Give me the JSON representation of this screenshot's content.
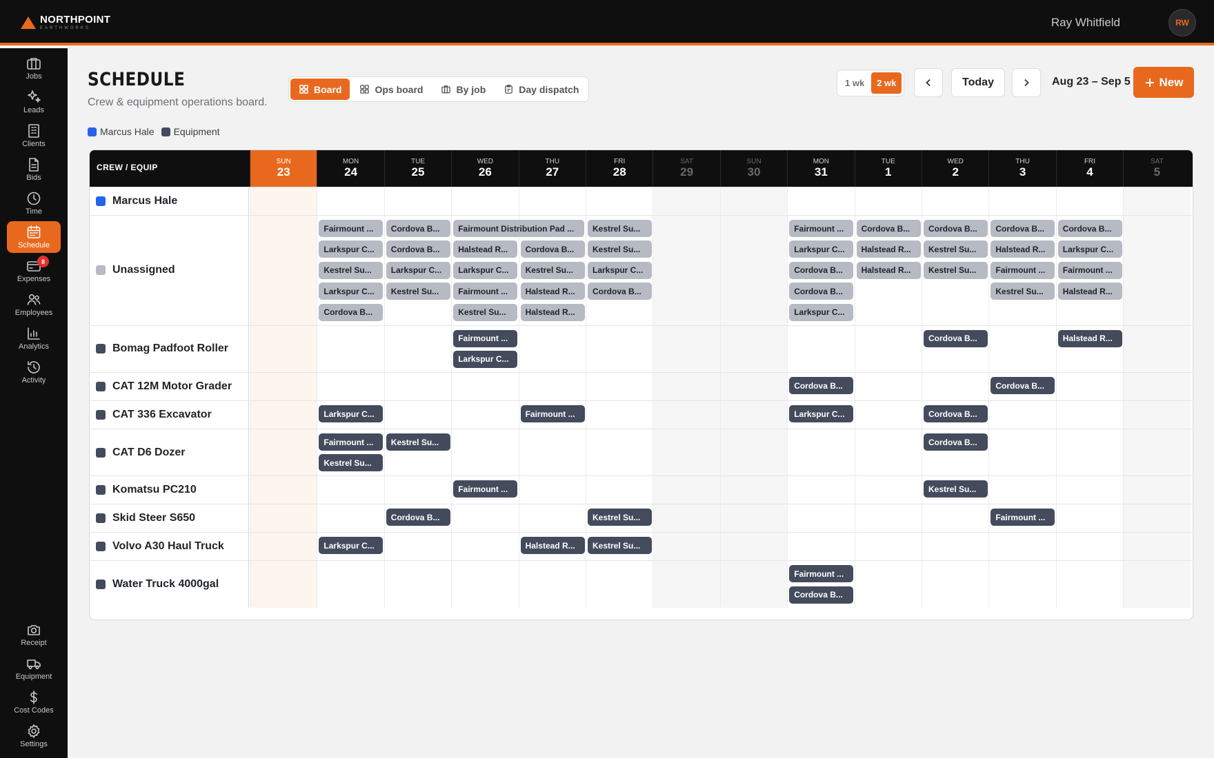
{
  "brand": {
    "name": "NORTHPOINT",
    "sub": "EARTHWORKS",
    "accent": "#e8691e"
  },
  "user": {
    "name": "Ray Whitfield",
    "initials": "RW"
  },
  "sidebar": {
    "items": [
      {
        "label": "Jobs",
        "icon": "briefcase-icon"
      },
      {
        "label": "Leads",
        "icon": "sparkles-icon"
      },
      {
        "label": "Clients",
        "icon": "building-icon"
      },
      {
        "label": "Bids",
        "icon": "document-icon"
      },
      {
        "label": "Time",
        "icon": "clock-icon"
      },
      {
        "label": "Schedule",
        "icon": "calendar-icon",
        "active": true
      },
      {
        "label": "Expenses",
        "icon": "credit-card-icon",
        "badge": "8"
      },
      {
        "label": "Employees",
        "icon": "users-icon"
      },
      {
        "label": "Analytics",
        "icon": "bar-chart-icon"
      },
      {
        "label": "Activity",
        "icon": "history-icon"
      }
    ],
    "bottom": [
      {
        "label": "Receipt",
        "icon": "camera-icon"
      },
      {
        "label": "Equipment",
        "icon": "truck-icon"
      },
      {
        "label": "Cost Codes",
        "icon": "dollar-icon"
      },
      {
        "label": "Settings",
        "icon": "gear-icon"
      }
    ]
  },
  "header": {
    "title": "SCHEDULE",
    "subtitle": "Crew & equipment operations board.",
    "views": [
      "Board",
      "Ops board",
      "By job",
      "Day dispatch"
    ],
    "active_view": "Board",
    "weeks": [
      "1 wk",
      "2 wk"
    ],
    "active_week": "2 wk",
    "today_label": "Today",
    "date_range": "Aug 23 – Sep 5",
    "new_label": "New"
  },
  "legend": [
    {
      "label": "Marcus Hale",
      "color": "#2563eb"
    },
    {
      "label": "Equipment",
      "color": "#434b5c"
    }
  ],
  "board": {
    "crew_header": "CREW / EQUIP",
    "days": [
      {
        "dow": "SUN",
        "num": "23",
        "today": true,
        "weekend": true
      },
      {
        "dow": "MON",
        "num": "24"
      },
      {
        "dow": "TUE",
        "num": "25"
      },
      {
        "dow": "WED",
        "num": "26"
      },
      {
        "dow": "THU",
        "num": "27"
      },
      {
        "dow": "FRI",
        "num": "28"
      },
      {
        "dow": "SAT",
        "num": "29",
        "weekend": true
      },
      {
        "dow": "SUN",
        "num": "30",
        "weekend": true
      },
      {
        "dow": "MON",
        "num": "31"
      },
      {
        "dow": "TUE",
        "num": "1"
      },
      {
        "dow": "WED",
        "num": "2"
      },
      {
        "dow": "THU",
        "num": "3"
      },
      {
        "dow": "FRI",
        "num": "4"
      },
      {
        "dow": "SAT",
        "num": "5",
        "weekend": true
      }
    ],
    "rows": [
      {
        "label": "Marcus Hale",
        "color": "#2563eb",
        "kind": "crew",
        "cells": [
          [],
          [],
          [],
          [],
          [],
          [],
          [],
          [],
          [],
          [],
          [],
          [],
          [],
          []
        ]
      },
      {
        "label": "Unassigned",
        "color": "#b6bac2",
        "kind": "unassigned",
        "cells": [
          [],
          [
            "Fairmount ...",
            "Larkspur C...",
            "Kestrel Su...",
            "Larkspur C...",
            "Cordova B..."
          ],
          [
            "Cordova B...",
            "Cordova B...",
            "Larkspur C...",
            "Kestrel Su..."
          ],
          [
            "Fairmount Distribution Pad ...",
            "Halstead R...",
            "Larkspur C...",
            "Fairmount ...",
            "Kestrel Su..."
          ],
          [
            "",
            "Cordova B...",
            "Kestrel Su...",
            "Halstead R...",
            "Halstead R..."
          ],
          [
            "Kestrel Su...",
            "Kestrel Su...",
            "Larkspur C...",
            "Cordova B..."
          ],
          [],
          [],
          [
            "Fairmount ...",
            "Larkspur C...",
            "Cordova B...",
            "Cordova B...",
            "Larkspur C..."
          ],
          [
            "Cordova B...",
            "Halstead R...",
            "Halstead R..."
          ],
          [
            "Cordova B...",
            "Kestrel Su...",
            "Kestrel Su..."
          ],
          [
            "Cordova B...",
            "Halstead R...",
            "Fairmount ...",
            "Kestrel Su..."
          ],
          [
            "Cordova B...",
            "Larkspur C...",
            "Fairmount ...",
            "Halstead R..."
          ],
          []
        ]
      },
      {
        "label": "Bomag Padfoot Roller",
        "color": "#434b5c",
        "kind": "equip",
        "cells": [
          [],
          [],
          [],
          [
            "Fairmount ...",
            "Larkspur C..."
          ],
          [],
          [],
          [],
          [],
          [],
          [],
          [
            "Cordova B..."
          ],
          [],
          [
            "Halstead R..."
          ],
          []
        ]
      },
      {
        "label": "CAT 12M Motor Grader",
        "color": "#434b5c",
        "kind": "equip",
        "cells": [
          [],
          [],
          [],
          [],
          [],
          [],
          [],
          [],
          [
            "Cordova B..."
          ],
          [],
          [],
          [
            "Cordova B..."
          ],
          [],
          []
        ]
      },
      {
        "label": "CAT 336 Excavator",
        "color": "#434b5c",
        "kind": "equip",
        "cells": [
          [],
          [
            "Larkspur C..."
          ],
          [],
          [],
          [
            "Fairmount ..."
          ],
          [],
          [],
          [],
          [
            "Larkspur C..."
          ],
          [],
          [
            "Cordova B..."
          ],
          [],
          [],
          []
        ]
      },
      {
        "label": "CAT D6 Dozer",
        "color": "#434b5c",
        "kind": "equip",
        "cells": [
          [],
          [
            "Fairmount ...",
            "Kestrel Su..."
          ],
          [
            "Kestrel Su..."
          ],
          [],
          [],
          [],
          [],
          [],
          [],
          [],
          [
            "Cordova B..."
          ],
          [],
          [],
          []
        ]
      },
      {
        "label": "Komatsu PC210",
        "color": "#434b5c",
        "kind": "equip",
        "cells": [
          [],
          [],
          [],
          [
            "Fairmount ..."
          ],
          [],
          [],
          [],
          [],
          [],
          [],
          [
            "Kestrel Su..."
          ],
          [],
          [],
          []
        ]
      },
      {
        "label": "Skid Steer S650",
        "color": "#434b5c",
        "kind": "equip",
        "cells": [
          [],
          [],
          [
            "Cordova B..."
          ],
          [],
          [],
          [
            "Kestrel Su..."
          ],
          [],
          [],
          [],
          [],
          [],
          [
            "Fairmount ..."
          ],
          [],
          []
        ]
      },
      {
        "label": "Volvo A30 Haul Truck",
        "color": "#434b5c",
        "kind": "equip",
        "cells": [
          [],
          [
            "Larkspur C..."
          ],
          [],
          [],
          [
            "Halstead R..."
          ],
          [
            "Kestrel Su..."
          ],
          [],
          [],
          [],
          [],
          [],
          [],
          [],
          []
        ]
      },
      {
        "label": "Water Truck 4000gal",
        "color": "#434b5c",
        "kind": "equip",
        "cells": [
          [],
          [],
          [],
          [],
          [],
          [],
          [],
          [],
          [
            "Fairmount ...",
            "Cordova B..."
          ],
          [],
          [],
          [],
          [],
          []
        ]
      }
    ]
  }
}
